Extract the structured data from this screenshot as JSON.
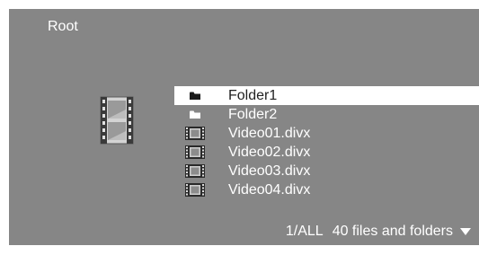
{
  "breadcrumb": "Root",
  "preview": {
    "icon": "film-icon"
  },
  "items": [
    {
      "label": "Folder1",
      "type": "folder",
      "icon": "folder-icon",
      "selected": true
    },
    {
      "label": "Folder2",
      "type": "folder",
      "icon": "folder-icon",
      "selected": false
    },
    {
      "label": "Video01.divx",
      "type": "video",
      "icon": "film-icon",
      "selected": false
    },
    {
      "label": "Video02.divx",
      "type": "video",
      "icon": "film-icon",
      "selected": false
    },
    {
      "label": "Video03.divx",
      "type": "video",
      "icon": "film-icon",
      "selected": false
    },
    {
      "label": "Video04.divx",
      "type": "video",
      "icon": "film-icon",
      "selected": false
    }
  ],
  "status": {
    "page": "1/ALL",
    "count_text": "40 files and folders",
    "more_icon": "triangle-down-icon"
  },
  "colors": {
    "background": "#868686",
    "text": "#ffffff",
    "selection": "#ffffff",
    "selected_text": "#222222"
  }
}
